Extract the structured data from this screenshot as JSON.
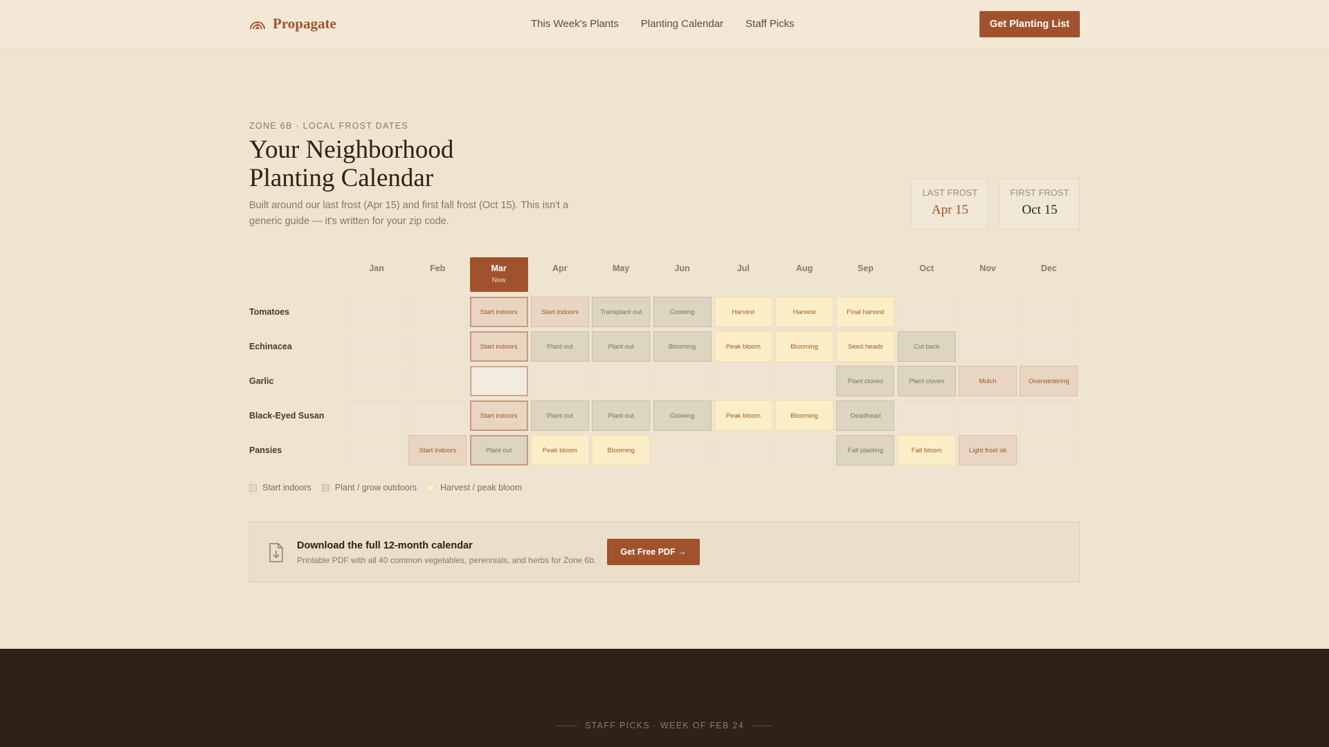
{
  "brand": {
    "name": "Propagate",
    "icon": "rainbow-arch-icon"
  },
  "nav": {
    "items": [
      "This Week's Plants",
      "Planting Calendar",
      "Staff Picks"
    ],
    "cta": "Get Planting List"
  },
  "hero": {
    "eyebrow": "ZONE 6B · LOCAL FROST DATES",
    "title_line1": "Your Neighborhood",
    "title_line2": "Planting Calendar",
    "subtitle": "Built around our last frost (Apr 15) and first fall frost (Oct 15). This isn't a generic guide — it's written for your zip code."
  },
  "frost": {
    "last": {
      "label": "LAST FROST",
      "value": "Apr 15"
    },
    "first": {
      "label": "FIRST FROST",
      "value": "Oct 15"
    }
  },
  "calendar": {
    "months": [
      "Jan",
      "Feb",
      "Mar",
      "Apr",
      "May",
      "Jun",
      "Jul",
      "Aug",
      "Sep",
      "Oct",
      "Nov",
      "Dec"
    ],
    "current_month": "Mar",
    "current_label": "Now",
    "rows": [
      {
        "plant": "Tomatoes",
        "cells": [
          null,
          null,
          {
            "text": "Start indoors",
            "kind": "indoor"
          },
          {
            "text": "Start indoors",
            "kind": "indoor"
          },
          {
            "text": "Transplant out",
            "kind": "outdoor"
          },
          {
            "text": "Growing",
            "kind": "outdoor"
          },
          {
            "text": "Harvest",
            "kind": "harvest"
          },
          {
            "text": "Harvest",
            "kind": "harvest"
          },
          {
            "text": "Final harvest",
            "kind": "harvest"
          },
          null,
          null,
          null
        ]
      },
      {
        "plant": "Echinacea",
        "cells": [
          null,
          null,
          {
            "text": "Start indoors",
            "kind": "indoor"
          },
          {
            "text": "Plant out",
            "kind": "outdoor"
          },
          {
            "text": "Plant out",
            "kind": "outdoor"
          },
          {
            "text": "Blooming",
            "kind": "outdoor"
          },
          {
            "text": "Peak bloom",
            "kind": "harvest"
          },
          {
            "text": "Blooming",
            "kind": "harvest"
          },
          {
            "text": "Seed heads",
            "kind": "harvest"
          },
          {
            "text": "Cut back",
            "kind": "outdoor"
          },
          null,
          null
        ]
      },
      {
        "plant": "Garlic",
        "cells": [
          null,
          null,
          null,
          null,
          null,
          null,
          null,
          null,
          {
            "text": "Plant cloves",
            "kind": "outdoor"
          },
          {
            "text": "Plant cloves",
            "kind": "outdoor"
          },
          {
            "text": "Mulch",
            "kind": "indoor"
          },
          {
            "text": "Overwintering",
            "kind": "indoor"
          }
        ]
      },
      {
        "plant": "Black-Eyed Susan",
        "cells": [
          null,
          null,
          {
            "text": "Start indoors",
            "kind": "indoor"
          },
          {
            "text": "Plant out",
            "kind": "outdoor"
          },
          {
            "text": "Plant out",
            "kind": "outdoor"
          },
          {
            "text": "Growing",
            "kind": "outdoor"
          },
          {
            "text": "Peak bloom",
            "kind": "harvest"
          },
          {
            "text": "Blooming",
            "kind": "harvest"
          },
          {
            "text": "Deadhead",
            "kind": "outdoor"
          },
          null,
          null,
          null
        ]
      },
      {
        "plant": "Pansies",
        "cells": [
          null,
          {
            "text": "Start indoors",
            "kind": "indoor"
          },
          {
            "text": "Plant out",
            "kind": "outdoor"
          },
          {
            "text": "Peak bloom",
            "kind": "harvest"
          },
          {
            "text": "Blooming",
            "kind": "harvest"
          },
          null,
          null,
          null,
          {
            "text": "Fall planting",
            "kind": "outdoor"
          },
          {
            "text": "Fall bloom",
            "kind": "harvest"
          },
          {
            "text": "Light frost ok",
            "kind": "indoor"
          },
          null
        ]
      }
    ]
  },
  "legend": [
    "Start indoors",
    "Plant / grow outdoors",
    "Harvest / peak bloom"
  ],
  "download": {
    "icon": "file-download-icon",
    "title": "Download the full 12-month calendar",
    "description": "Printable PDF with all 40 common vegetables, perennials, and herbs for Zone 6b.",
    "button": "Get Free PDF →"
  },
  "staff_picks": {
    "eyebrow": "STAFF PICKS · WEEK OF FEB 24"
  },
  "colors": {
    "accent": "#a0522d",
    "background": "#efe4cf",
    "dark": "#2d2118"
  }
}
